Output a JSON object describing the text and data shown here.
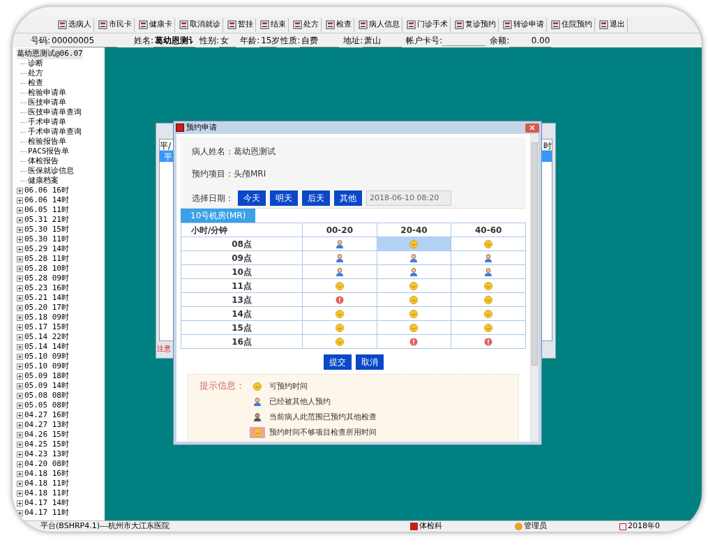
{
  "toolbar": [
    {
      "label": "选病人"
    },
    {
      "label": "市民卡"
    },
    {
      "label": "健康卡"
    },
    {
      "label": "取消就诊"
    },
    {
      "label": "暂挂"
    },
    {
      "label": "结束"
    },
    {
      "label": "处方"
    },
    {
      "label": "检查"
    },
    {
      "label": "病人信息"
    },
    {
      "label": "门诊手术"
    },
    {
      "label": "复诊预约"
    },
    {
      "label": "转诊申请"
    },
    {
      "label": "住院预约"
    },
    {
      "label": "退出"
    }
  ],
  "patient_bar": [
    {
      "label": "号码:",
      "value": "00000005"
    },
    {
      "label": "姓名:",
      "value": "葛幼恩测讠"
    },
    {
      "label": "性别:",
      "value": "女"
    },
    {
      "label": "年龄:",
      "value": "15岁"
    },
    {
      "label": "性质:",
      "value": "自费"
    },
    {
      "label": "地址:",
      "value": "萧山"
    },
    {
      "label": "帐户卡号:"
    },
    {
      "label": "余额:",
      "value": "0.00"
    }
  ],
  "tree": [
    {
      "label": "葛幼恩测试@06.07",
      "expanded": true,
      "children": [
        {
          "label": "诊断"
        },
        {
          "label": "处方"
        },
        {
          "label": "检查"
        },
        {
          "label": "检验申请单"
        },
        {
          "label": "医技申请单"
        },
        {
          "label": "医技申请单查询"
        },
        {
          "label": "手术申请单"
        },
        {
          "label": "手术申请单查询"
        },
        {
          "label": "检验报告单"
        },
        {
          "label": "PACS报告单"
        },
        {
          "label": "体检报告"
        },
        {
          "label": "医保就诊信息"
        },
        {
          "label": "健康档案"
        }
      ]
    },
    {
      "label": "06.06 16时",
      "expanded": false
    },
    {
      "label": "06.06 14时",
      "expanded": false
    },
    {
      "label": "06.05 11时",
      "expanded": false
    },
    {
      "label": "05.31 21时",
      "expanded": false
    },
    {
      "label": "05.30 15时",
      "expanded": false
    },
    {
      "label": "05.30 11时",
      "expanded": false
    },
    {
      "label": "05.29 14时",
      "expanded": false
    },
    {
      "label": "05.28 11时",
      "expanded": false
    },
    {
      "label": "05.28 10时",
      "expanded": false
    },
    {
      "label": "05.28 09时",
      "expanded": false
    },
    {
      "label": "05.23 16时",
      "expanded": false
    },
    {
      "label": "05.21 14时",
      "expanded": false
    },
    {
      "label": "05.20 17时",
      "expanded": false
    },
    {
      "label": "05.18 09时",
      "expanded": false
    },
    {
      "label": "05.17 15时",
      "expanded": false
    },
    {
      "label": "05.14 22时",
      "expanded": false
    },
    {
      "label": "05.14 14时",
      "expanded": false
    },
    {
      "label": "05.10 09时",
      "expanded": false
    },
    {
      "label": "05.10 09时",
      "expanded": false
    },
    {
      "label": "05.09 18时",
      "expanded": false
    },
    {
      "label": "05.09 14时",
      "expanded": false
    },
    {
      "label": "05.08 08时",
      "expanded": false
    },
    {
      "label": "05.05 08时",
      "expanded": false
    },
    {
      "label": "04.27 16时",
      "expanded": false
    },
    {
      "label": "04.27 13时",
      "expanded": false
    },
    {
      "label": "04.26 15时",
      "expanded": false
    },
    {
      "label": "04.25 15时",
      "expanded": false
    },
    {
      "label": "04.23 13时",
      "expanded": false
    },
    {
      "label": "04.20 08时",
      "expanded": false
    },
    {
      "label": "04.18 16时",
      "expanded": false
    },
    {
      "label": "04.18 11时",
      "expanded": false
    },
    {
      "label": "04.18 11时",
      "expanded": false
    },
    {
      "label": "04.17 14时",
      "expanded": false
    },
    {
      "label": "04.17 11时",
      "expanded": false
    }
  ],
  "back_window": {
    "column_1": "平/",
    "column_2": "时",
    "row": "平",
    "note": "注意"
  },
  "dialog": {
    "title": "预约申请",
    "patient_label": "病人姓名：",
    "patient_value": "葛幼恩测试",
    "item_label": "预约项目：",
    "item_value": "头颅MRI",
    "date_label": "选择日期：",
    "date_buttons": [
      "今天",
      "明天",
      "后天",
      "其他"
    ],
    "date_value": "2018-06-10 08:20",
    "room_tab": "10号机房(MR)",
    "columns": [
      "小时/分钟",
      "00-20",
      "20-40",
      "40-60"
    ],
    "rows": [
      {
        "hour": "08点",
        "cells": [
          {
            "kind": "booked",
            "selected": false
          },
          {
            "kind": "free",
            "selected": true
          },
          {
            "kind": "free",
            "selected": false
          }
        ]
      },
      {
        "hour": "09点",
        "cells": [
          {
            "kind": "booked",
            "selected": false
          },
          {
            "kind": "booked",
            "selected": false
          },
          {
            "kind": "booked",
            "selected": false
          }
        ]
      },
      {
        "hour": "10点",
        "cells": [
          {
            "kind": "booked",
            "selected": false
          },
          {
            "kind": "booked",
            "selected": false
          },
          {
            "kind": "booked",
            "selected": false
          }
        ]
      },
      {
        "hour": "11点",
        "cells": [
          {
            "kind": "free",
            "selected": false
          },
          {
            "kind": "free",
            "selected": false
          },
          {
            "kind": "free",
            "selected": false
          }
        ]
      },
      {
        "hour": "13点",
        "cells": [
          {
            "kind": "blocked",
            "selected": false
          },
          {
            "kind": "free",
            "selected": false
          },
          {
            "kind": "free",
            "selected": false
          }
        ]
      },
      {
        "hour": "14点",
        "cells": [
          {
            "kind": "free",
            "selected": false
          },
          {
            "kind": "free",
            "selected": false
          },
          {
            "kind": "free",
            "selected": false
          }
        ]
      },
      {
        "hour": "15点",
        "cells": [
          {
            "kind": "free",
            "selected": false
          },
          {
            "kind": "free",
            "selected": false
          },
          {
            "kind": "free",
            "selected": false
          }
        ]
      },
      {
        "hour": "16点",
        "cells": [
          {
            "kind": "free",
            "selected": false
          },
          {
            "kind": "blocked",
            "selected": false
          },
          {
            "kind": "blocked",
            "selected": false
          }
        ]
      }
    ],
    "buttons": [
      "提交",
      "取消"
    ],
    "legend_title": "提示信息：",
    "legend": [
      {
        "kind": "free",
        "text": "可预约时间"
      },
      {
        "kind": "booked",
        "text": "已经被其他人预约"
      },
      {
        "kind": "self",
        "text": "当前病人此范围已预约其他检查"
      },
      {
        "kind": "short",
        "text": "预约时间不够项目检查所用时间"
      }
    ]
  },
  "status_bar": [
    {
      "kind": "text",
      "text": "平台(BSHRP4.1)---杭州市大江东医院"
    },
    {
      "kind": "dept",
      "text": "体检科"
    },
    {
      "kind": "user",
      "text": "管理员"
    },
    {
      "kind": "date",
      "text": "2018年0"
    }
  ]
}
